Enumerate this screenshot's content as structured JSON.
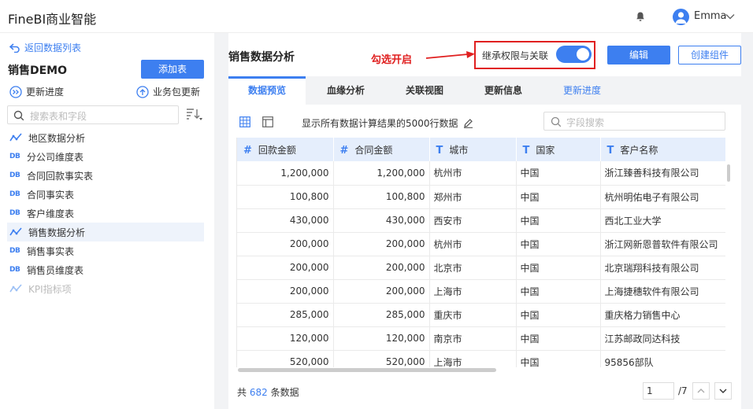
{
  "app": {
    "title": "FineBI商业智能",
    "user": "Emma"
  },
  "sidebar": {
    "back_label": "返回数据列表",
    "package_title": "销售DEMO",
    "add_table_label": "添加表",
    "update_progress_label": "更新进度",
    "package_update_label": "业务包更新",
    "search_placeholder": "搜索表和字段",
    "tables": [
      {
        "label": "地区数据分析",
        "icon": "analysis-icon"
      },
      {
        "label": "分公司维度表",
        "icon": "db-icon"
      },
      {
        "label": "合同回款事实表",
        "icon": "db-icon"
      },
      {
        "label": "合同事实表",
        "icon": "db-icon"
      },
      {
        "label": "客户维度表",
        "icon": "db-icon"
      },
      {
        "label": "销售数据分析",
        "icon": "analysis-icon"
      },
      {
        "label": "销售事实表",
        "icon": "db-icon"
      },
      {
        "label": "销售员维度表",
        "icon": "db-icon"
      },
      {
        "label": "KPI指标项",
        "icon": "analysis-icon"
      }
    ]
  },
  "main": {
    "title": "销售数据分析",
    "annotation": "勾选开启",
    "inherit_label": "继承权限与关联",
    "inherit_enabled": true,
    "edit_label": "编辑",
    "new_component_label": "创建组件",
    "tabs": [
      {
        "label": "数据预览"
      },
      {
        "label": "血缘分析"
      },
      {
        "label": "关联视图"
      },
      {
        "label": "更新信息"
      },
      {
        "label": "更新进度"
      }
    ],
    "show_text": "显示所有数据计算结果的5000行数据",
    "field_search_placeholder": "字段搜索",
    "columns": [
      {
        "type": "#",
        "name": "回款金额"
      },
      {
        "type": "#",
        "name": "合同金额"
      },
      {
        "type": "T",
        "name": "城市"
      },
      {
        "type": "T",
        "name": "国家"
      },
      {
        "type": "T",
        "name": "客户名称"
      }
    ],
    "rows": [
      [
        "1,200,000",
        "1,200,000",
        "杭州市",
        "中国",
        "浙江臻善科技有限公司"
      ],
      [
        "100,800",
        "100,800",
        "郑州市",
        "中国",
        "杭州明佑电子有限公司"
      ],
      [
        "430,000",
        "430,000",
        "西安市",
        "中国",
        "西北工业大学"
      ],
      [
        "200,000",
        "200,000",
        "杭州市",
        "中国",
        "浙江网新恩普软件有限公司"
      ],
      [
        "200,000",
        "200,000",
        "北京市",
        "中国",
        "北京瑞翔科技有限公司"
      ],
      [
        "200,000",
        "200,000",
        "上海市",
        "中国",
        "上海捷穗软件有限公司"
      ],
      [
        "285,000",
        "285,000",
        "重庆市",
        "中国",
        "重庆格力销售中心"
      ],
      [
        "120,000",
        "120,000",
        "南京市",
        "中国",
        "江苏邮政同达科技"
      ],
      [
        "520,000",
        "520,000",
        "上海市",
        "中国",
        "95856部队"
      ]
    ],
    "footer": {
      "prefix": "共",
      "count": "682",
      "suffix": "条数据"
    },
    "pagination": {
      "current": "1",
      "total": "/7"
    }
  },
  "colors": {
    "accent": "#3d7ff0",
    "annotation": "#e02020",
    "header_bg": "#e5eefc"
  }
}
